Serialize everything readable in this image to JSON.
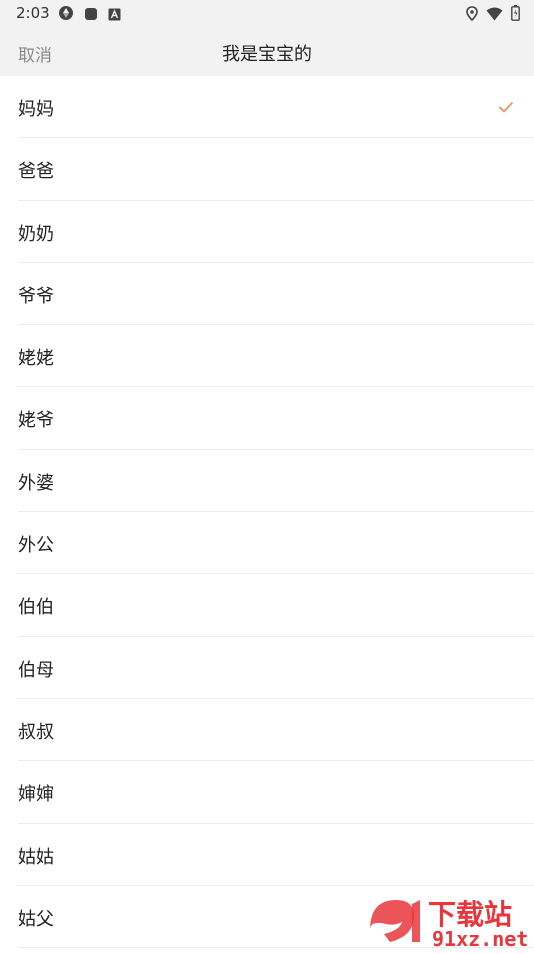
{
  "status_bar": {
    "time": "2:03",
    "icons_left": [
      "aperture-icon",
      "stop-square-icon",
      "a-box-icon"
    ],
    "icons_right": [
      "location-pin-icon",
      "wifi-icon",
      "battery-icon"
    ]
  },
  "header": {
    "cancel_label": "取消",
    "title": "我是宝宝的"
  },
  "relations": [
    {
      "label": "妈妈",
      "selected": true
    },
    {
      "label": "爸爸",
      "selected": false
    },
    {
      "label": "奶奶",
      "selected": false
    },
    {
      "label": "爷爷",
      "selected": false
    },
    {
      "label": "姥姥",
      "selected": false
    },
    {
      "label": "姥爷",
      "selected": false
    },
    {
      "label": "外婆",
      "selected": false
    },
    {
      "label": "外公",
      "selected": false
    },
    {
      "label": "伯伯",
      "selected": false
    },
    {
      "label": "伯母",
      "selected": false
    },
    {
      "label": "叔叔",
      "selected": false
    },
    {
      "label": "婶婶",
      "selected": false
    },
    {
      "label": "姑姑",
      "selected": false
    },
    {
      "label": "姑父",
      "selected": false
    }
  ],
  "colors": {
    "accent": "#f08a5d",
    "bar_bg": "#f2f2f2",
    "watermark_red": "#e8363c"
  },
  "watermark": {
    "brand_text": "下载站",
    "domain_text": "91xz.net"
  }
}
